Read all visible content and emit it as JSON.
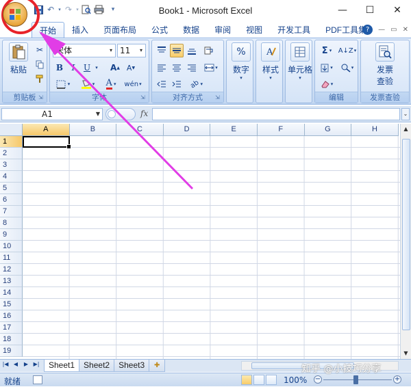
{
  "window": {
    "title": "Book1 - Microsoft Excel",
    "minimize_glyph": "—",
    "maximize_glyph": "☐",
    "close_glyph": "✕"
  },
  "quick_access": [
    "save-icon",
    "undo-icon",
    "redo-icon",
    "print-preview-icon",
    "print-icon",
    "customize-icon"
  ],
  "tabs": [
    "开始",
    "插入",
    "页面布局",
    "公式",
    "数据",
    "审阅",
    "视图",
    "开发工具",
    "PDF工具集"
  ],
  "active_tab": "开始",
  "ribbon": {
    "clipboard": {
      "label": "剪贴板",
      "paste_label": "粘贴"
    },
    "font": {
      "label": "字体",
      "font_name": "宋体",
      "font_size": "11",
      "bold": "B",
      "italic": "I",
      "underline": "U"
    },
    "alignment": {
      "label": "对齐方式"
    },
    "number": {
      "label": "数字",
      "button": "数字"
    },
    "styles": {
      "button": "样式"
    },
    "cells": {
      "button": "单元格"
    },
    "editing": {
      "label": "编辑"
    },
    "invoice": {
      "label": "发票查验",
      "button_line1": "发票",
      "button_line2": "查验"
    }
  },
  "formula_bar": {
    "name_box": "A1",
    "fx_label": "fx",
    "formula": ""
  },
  "grid": {
    "columns": [
      "A",
      "B",
      "C",
      "D",
      "E",
      "F",
      "G",
      "H"
    ],
    "rows": [
      "1",
      "2",
      "3",
      "4",
      "5",
      "6",
      "7",
      "8",
      "9",
      "10",
      "11",
      "12",
      "13",
      "14",
      "15",
      "16",
      "17",
      "18",
      "19"
    ],
    "active_cell": "A1"
  },
  "sheets": [
    "Sheet1",
    "Sheet2",
    "Sheet3"
  ],
  "active_sheet": "Sheet1",
  "status": {
    "ready": "就绪",
    "zoom": "100%",
    "zoom_minus": "−",
    "zoom_plus": "+"
  },
  "watermark": "知乎 @小技巧分享",
  "annotation": {
    "circle_color": "#e8232a",
    "arrow_color": "#e13de6"
  }
}
